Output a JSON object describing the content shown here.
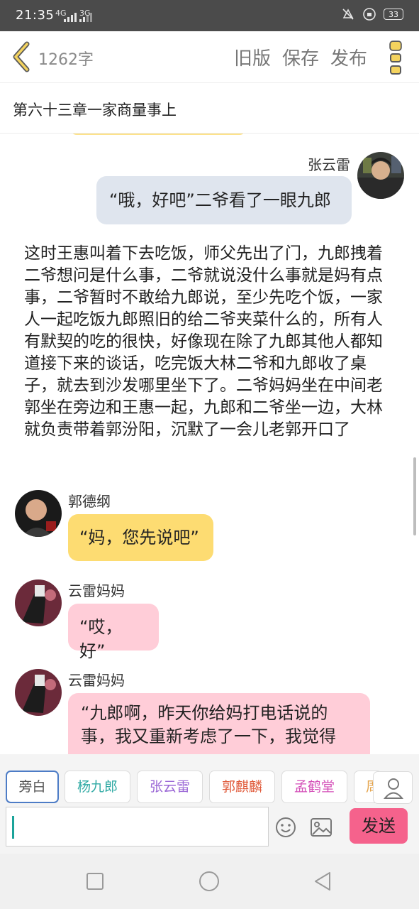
{
  "status_bar": {
    "time": "21:35",
    "net1": "4G",
    "net2": "3G",
    "battery": "33"
  },
  "top_bar": {
    "word_count": "1262字",
    "old_version": "旧版",
    "save": "保存",
    "publish": "发布"
  },
  "chapter_title": "第六十三章一家商量事上",
  "messages": [
    {
      "speaker": "张云雷",
      "text": "“哦，好吧”二爷看了一眼九郎"
    },
    {
      "narration": "这时王惠叫着下去吃饭，师父先出了门，九郎拽着二爷想问是什么事，二爷就说没什么事就是妈有点事，二爷暂时不敢给九郎说，至少先吃个饭，一家人一起吃饭九郎照旧的给二爷夹菜什么的，所有人有默契的吃的很快，好像现在除了九郎其他人都知道接下来的谈话，吃完饭大林二爷和九郎收了桌子，就去到沙发哪里坐下了。二爷妈妈坐在中间老郭坐在旁边和王惠一起，九郎和二爷坐一边，大林就负责带着郭汾阳，沉默了一会儿老郭开口了"
    },
    {
      "speaker": "郭德纲",
      "text": "“妈，您先说吧”"
    },
    {
      "speaker": "云雷妈妈",
      "text": "“哎，好”"
    },
    {
      "speaker": "云雷妈妈",
      "text": "“九郎啊，昨天你给妈打电话说的事，我又重新考虑了一下，我觉得"
    }
  ],
  "characters": [
    {
      "label": "旁白",
      "color": "#555555"
    },
    {
      "label": "杨九郎",
      "color": "#2ea9a3"
    },
    {
      "label": "张云雷",
      "color": "#9b68d6"
    },
    {
      "label": "郭麒麟",
      "color": "#e05a3a"
    },
    {
      "label": "孟鹤堂",
      "color": "#d44fb8"
    },
    {
      "label": "周",
      "color": "#e4a34a"
    }
  ],
  "input": {
    "value": ""
  },
  "send_label": "发送"
}
